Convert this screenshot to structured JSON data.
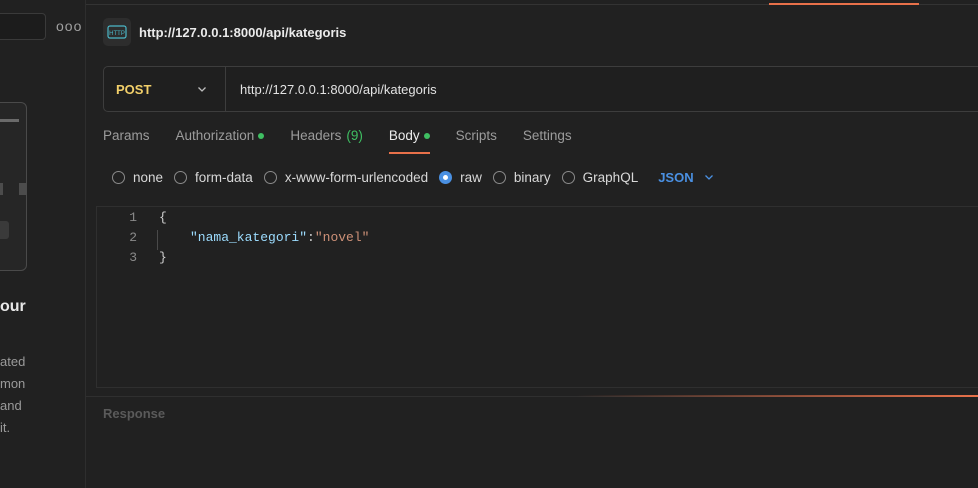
{
  "sidebar": {
    "more_label": "ooo",
    "promo_title": "our",
    "promo_lines": [
      "ated",
      "mon",
      "and",
      "it."
    ]
  },
  "request": {
    "icon": "http-icon",
    "icon_text": "HTTP",
    "title": "http://127.0.0.1:8000/api/kategoris",
    "method": "POST",
    "url": "http://127.0.0.1:8000/api/kategoris"
  },
  "tabs": [
    {
      "label": "Params"
    },
    {
      "label": "Authorization",
      "dot": true
    },
    {
      "label": "Headers",
      "count": "(9)"
    },
    {
      "label": "Body",
      "dot": true,
      "active": true
    },
    {
      "label": "Scripts"
    },
    {
      "label": "Settings"
    }
  ],
  "body_types": {
    "options": [
      "none",
      "form-data",
      "x-www-form-urlencoded",
      "raw",
      "binary",
      "GraphQL"
    ],
    "selected": "raw",
    "format": "JSON"
  },
  "editor": {
    "line_numbers": [
      "1",
      "2",
      "3"
    ],
    "open_brace": "{",
    "key": "\"nama_kategori\"",
    "colon": ":",
    "value": "\"novel\"",
    "close_brace": "}"
  },
  "response": {
    "label": "Response"
  },
  "colors": {
    "accent": "#e8714a",
    "method": "#f3d06a",
    "dot": "#3fbf62",
    "link": "#4a90e2"
  }
}
